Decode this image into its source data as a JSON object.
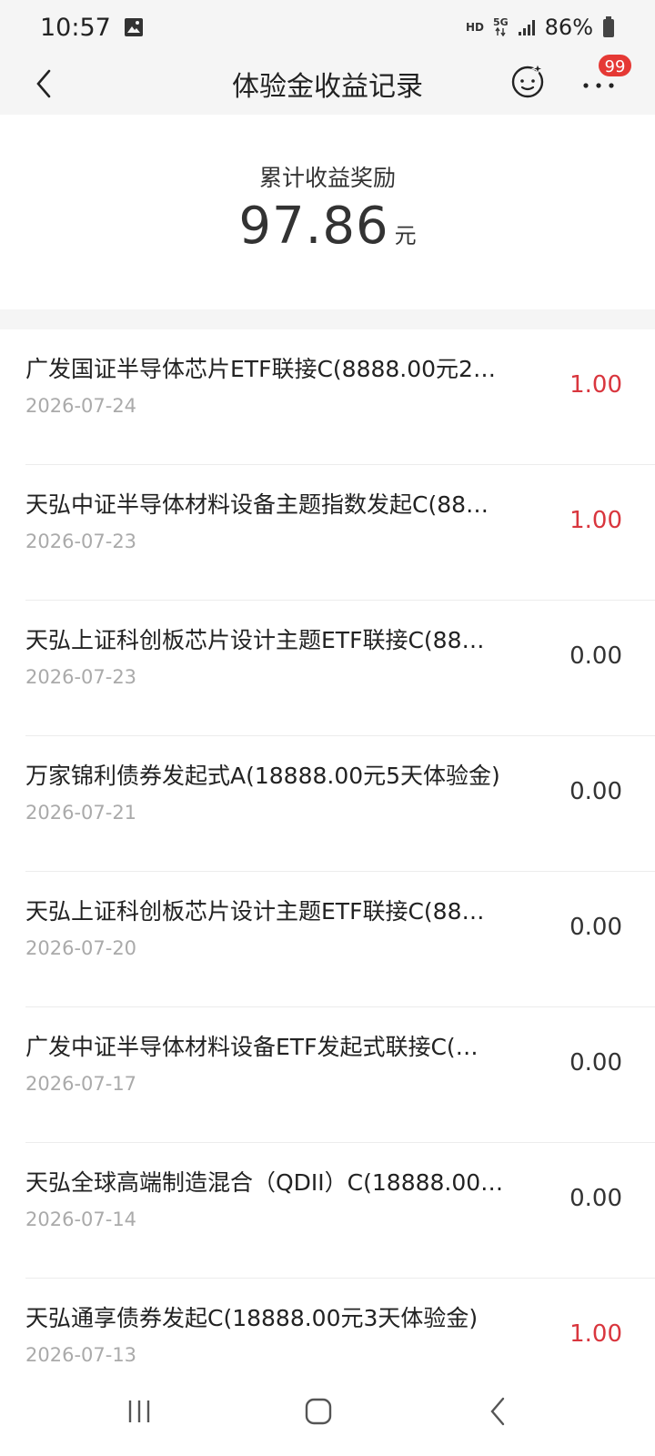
{
  "status_bar": {
    "time": "10:57",
    "hd": "HD",
    "network": "5G",
    "battery": "86%"
  },
  "header": {
    "title": "体验金收益记录",
    "badge_count": "99"
  },
  "summary": {
    "label": "累计收益奖励",
    "amount": "97.86",
    "unit": "元"
  },
  "records": [
    {
      "name": "广发国证半导体芯片ETF联接C(8888.00元2…",
      "date": "2026-07-24",
      "value": "1.00",
      "positive": true
    },
    {
      "name": "天弘中证半导体材料设备主题指数发起C(88…",
      "date": "2026-07-23",
      "value": "1.00",
      "positive": true
    },
    {
      "name": "天弘上证科创板芯片设计主题ETF联接C(88…",
      "date": "2026-07-23",
      "value": "0.00",
      "positive": false
    },
    {
      "name": "万家锦利债券发起式A(18888.00元5天体验金)",
      "date": "2026-07-21",
      "value": "0.00",
      "positive": false
    },
    {
      "name": "天弘上证科创板芯片设计主题ETF联接C(88…",
      "date": "2026-07-20",
      "value": "0.00",
      "positive": false
    },
    {
      "name": "广发中证半导体材料设备ETF发起式联接C(…",
      "date": "2026-07-17",
      "value": "0.00",
      "positive": false
    },
    {
      "name": "天弘全球高端制造混合（QDII）C(18888.00…",
      "date": "2026-07-14",
      "value": "0.00",
      "positive": false
    },
    {
      "name": "天弘通享债券发起C(18888.00元3天体验金)",
      "date": "2026-07-13",
      "value": "1.00",
      "positive": true
    }
  ],
  "colors": {
    "positive": "#d9363e",
    "neutral": "#333333",
    "badge": "#e53935"
  },
  "icons": {
    "back": "chevron-left-icon",
    "face": "smiley-sparkle-icon",
    "more": "more-dots-icon",
    "nav_recents": "recents-icon",
    "nav_home": "home-icon",
    "nav_back": "back-icon"
  }
}
